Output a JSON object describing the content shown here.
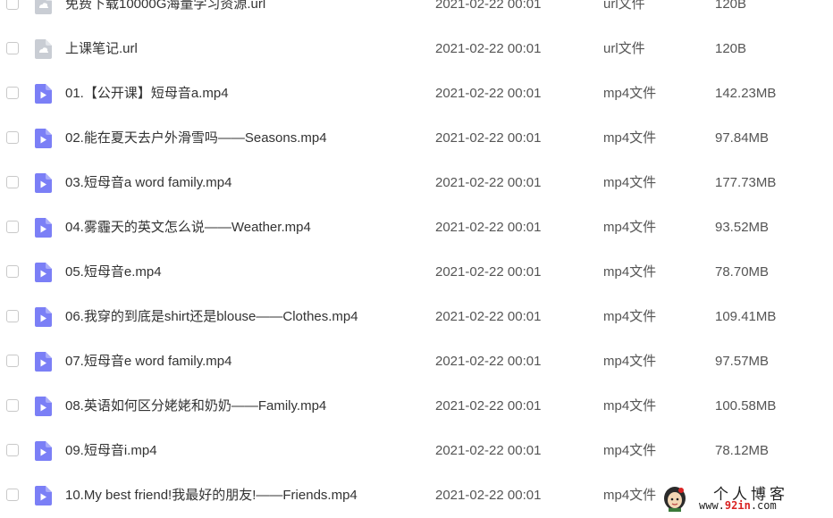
{
  "files": [
    {
      "name": "免费下载10000G海量学习资源.url",
      "date": "2021-02-22 00:01",
      "type": "url文件",
      "size": "120B",
      "icon": "url-file-icon"
    },
    {
      "name": "上课笔记.url",
      "date": "2021-02-22 00:01",
      "type": "url文件",
      "size": "120B",
      "icon": "url-file-icon"
    },
    {
      "name": "01.【公开课】短母音a.mp4",
      "date": "2021-02-22 00:01",
      "type": "mp4文件",
      "size": "142.23MB",
      "icon": "video-file-icon"
    },
    {
      "name": "02.能在夏天去户外滑雪吗——Seasons.mp4",
      "date": "2021-02-22 00:01",
      "type": "mp4文件",
      "size": "97.84MB",
      "icon": "video-file-icon"
    },
    {
      "name": "03.短母音a word family.mp4",
      "date": "2021-02-22 00:01",
      "type": "mp4文件",
      "size": "177.73MB",
      "icon": "video-file-icon"
    },
    {
      "name": "04.雾霾天的英文怎么说——Weather.mp4",
      "date": "2021-02-22 00:01",
      "type": "mp4文件",
      "size": "93.52MB",
      "icon": "video-file-icon"
    },
    {
      "name": "05.短母音e.mp4",
      "date": "2021-02-22 00:01",
      "type": "mp4文件",
      "size": "78.70MB",
      "icon": "video-file-icon"
    },
    {
      "name": "06.我穿的到底是shirt还是blouse——Clothes.mp4",
      "date": "2021-02-22 00:01",
      "type": "mp4文件",
      "size": "109.41MB",
      "icon": "video-file-icon"
    },
    {
      "name": "07.短母音e word family.mp4",
      "date": "2021-02-22 00:01",
      "type": "mp4文件",
      "size": "97.57MB",
      "icon": "video-file-icon"
    },
    {
      "name": "08.英语如何区分姥姥和奶奶——Family.mp4",
      "date": "2021-02-22 00:01",
      "type": "mp4文件",
      "size": "100.58MB",
      "icon": "video-file-icon"
    },
    {
      "name": "09.短母音i.mp4",
      "date": "2021-02-22 00:01",
      "type": "mp4文件",
      "size": "78.12MB",
      "icon": "video-file-icon"
    },
    {
      "name": "10.My best friend!我最好的朋友!——Friends.mp4",
      "date": "2021-02-22 00:01",
      "type": "mp4文件",
      "size": "",
      "icon": "video-file-icon"
    }
  ],
  "watermark": {
    "title": "个人博客",
    "url_prefix": "www.",
    "url_highlight": "92in",
    "url_suffix": ".com",
    "icon": "cartoon-avatar-icon"
  },
  "colors": {
    "video_icon": "#7B7FF6",
    "url_icon": "#C9CDD4",
    "text_primary": "#333333",
    "text_secondary": "#555555",
    "checkbox_border": "#C9C9C9",
    "watermark_highlight": "#D92323"
  }
}
